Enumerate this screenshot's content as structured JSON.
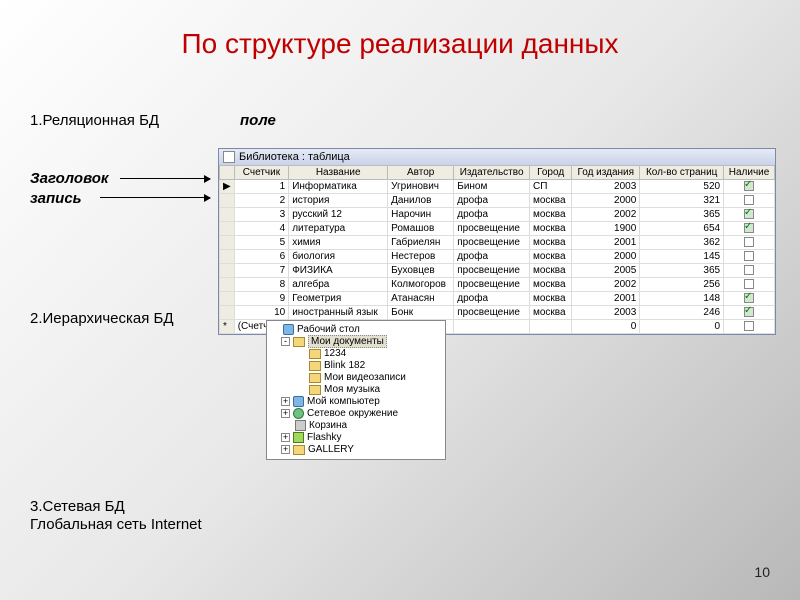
{
  "title": "По структуре реализации данных",
  "labels": {
    "relational": "1.Реляционная БД",
    "field": "поле",
    "header": "Заголовок",
    "record": "запись",
    "hierarchical": "2.Иерархическая БД",
    "network": "3.Сетевая БД",
    "internet": "Глобальная сеть Internet"
  },
  "page_number": "10",
  "table": {
    "window_title": "Библиотека : таблица",
    "columns": [
      "Счетчик",
      "Название",
      "Автор",
      "Издательство",
      "Город",
      "Год издания",
      "Кол-во страниц",
      "Наличие"
    ],
    "rows": [
      {
        "n": "1",
        "name": "Информатика",
        "author": "Угринович",
        "pub": "Бином",
        "city": "СП",
        "year": "2003",
        "pages": "520",
        "avail": true
      },
      {
        "n": "2",
        "name": "история",
        "author": "Данилов",
        "pub": "дрофа",
        "city": "москва",
        "year": "2000",
        "pages": "321",
        "avail": false
      },
      {
        "n": "3",
        "name": "русский 12",
        "author": "Нарочин",
        "pub": "дрофа",
        "city": "москва",
        "year": "2002",
        "pages": "365",
        "avail": true
      },
      {
        "n": "4",
        "name": "литература",
        "author": "Ромашов",
        "pub": "просвещение",
        "city": "москва",
        "year": "1900",
        "pages": "654",
        "avail": true
      },
      {
        "n": "5",
        "name": "химия",
        "author": "Габриелян",
        "pub": "просвещение",
        "city": "москва",
        "year": "2001",
        "pages": "362",
        "avail": false
      },
      {
        "n": "6",
        "name": "биология",
        "author": "Нестеров",
        "pub": "дрофа",
        "city": "москва",
        "year": "2000",
        "pages": "145",
        "avail": false
      },
      {
        "n": "7",
        "name": "ФИЗИКА",
        "author": "Буховцев",
        "pub": "просвещение",
        "city": "москва",
        "year": "2005",
        "pages": "365",
        "avail": false
      },
      {
        "n": "8",
        "name": "алгебра",
        "author": "Колмогоров",
        "pub": "просвещение",
        "city": "москва",
        "year": "2002",
        "pages": "256",
        "avail": false
      },
      {
        "n": "9",
        "name": "Геометрия",
        "author": "Атанасян",
        "pub": "дрофа",
        "city": "москва",
        "year": "2001",
        "pages": "148",
        "avail": true
      },
      {
        "n": "10",
        "name": "иностранный язык",
        "author": "Бонк",
        "pub": "просвещение",
        "city": "москва",
        "year": "2003",
        "pages": "246",
        "avail": true
      }
    ],
    "footer": {
      "label": "(Счетчик)",
      "pages": "0",
      "avail_empty": "0"
    }
  },
  "tree": {
    "items": [
      {
        "icon": "dico",
        "label": "Рабочий стол",
        "indent": 0,
        "ex": ""
      },
      {
        "icon": "fico",
        "label": "Мои документы",
        "indent": 1,
        "ex": "-",
        "sel": true
      },
      {
        "icon": "fico",
        "label": "1234",
        "indent": 2,
        "ex": ""
      },
      {
        "icon": "fico",
        "label": "Blink 182",
        "indent": 2,
        "ex": ""
      },
      {
        "icon": "fico",
        "label": "Мои видеозаписи",
        "indent": 2,
        "ex": ""
      },
      {
        "icon": "fico",
        "label": "Моя музыка",
        "indent": 2,
        "ex": ""
      },
      {
        "icon": "dico",
        "label": "Мой компьютер",
        "indent": 1,
        "ex": "+"
      },
      {
        "icon": "gico",
        "label": "Сетевое окружение",
        "indent": 1,
        "ex": "+"
      },
      {
        "icon": "bico",
        "label": "Корзина",
        "indent": 1,
        "ex": ""
      },
      {
        "icon": "uico",
        "label": "Flashky",
        "indent": 1,
        "ex": "+"
      },
      {
        "icon": "fico",
        "label": "GALLERY",
        "indent": 1,
        "ex": "+"
      }
    ]
  }
}
